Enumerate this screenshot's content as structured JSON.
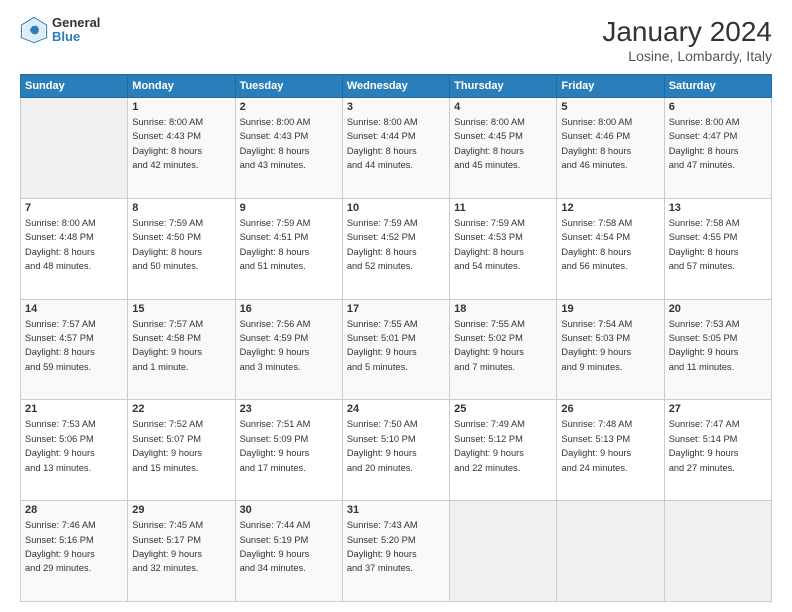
{
  "header": {
    "logo_line1": "General",
    "logo_line2": "Blue",
    "title": "January 2024",
    "subtitle": "Losine, Lombardy, Italy"
  },
  "days_of_week": [
    "Sunday",
    "Monday",
    "Tuesday",
    "Wednesday",
    "Thursday",
    "Friday",
    "Saturday"
  ],
  "weeks": [
    [
      {
        "day": "",
        "info": ""
      },
      {
        "day": "1",
        "info": "Sunrise: 8:00 AM\nSunset: 4:43 PM\nDaylight: 8 hours\nand 42 minutes."
      },
      {
        "day": "2",
        "info": "Sunrise: 8:00 AM\nSunset: 4:43 PM\nDaylight: 8 hours\nand 43 minutes."
      },
      {
        "day": "3",
        "info": "Sunrise: 8:00 AM\nSunset: 4:44 PM\nDaylight: 8 hours\nand 44 minutes."
      },
      {
        "day": "4",
        "info": "Sunrise: 8:00 AM\nSunset: 4:45 PM\nDaylight: 8 hours\nand 45 minutes."
      },
      {
        "day": "5",
        "info": "Sunrise: 8:00 AM\nSunset: 4:46 PM\nDaylight: 8 hours\nand 46 minutes."
      },
      {
        "day": "6",
        "info": "Sunrise: 8:00 AM\nSunset: 4:47 PM\nDaylight: 8 hours\nand 47 minutes."
      }
    ],
    [
      {
        "day": "7",
        "info": "Sunrise: 8:00 AM\nSunset: 4:48 PM\nDaylight: 8 hours\nand 48 minutes."
      },
      {
        "day": "8",
        "info": "Sunrise: 7:59 AM\nSunset: 4:50 PM\nDaylight: 8 hours\nand 50 minutes."
      },
      {
        "day": "9",
        "info": "Sunrise: 7:59 AM\nSunset: 4:51 PM\nDaylight: 8 hours\nand 51 minutes."
      },
      {
        "day": "10",
        "info": "Sunrise: 7:59 AM\nSunset: 4:52 PM\nDaylight: 8 hours\nand 52 minutes."
      },
      {
        "day": "11",
        "info": "Sunrise: 7:59 AM\nSunset: 4:53 PM\nDaylight: 8 hours\nand 54 minutes."
      },
      {
        "day": "12",
        "info": "Sunrise: 7:58 AM\nSunset: 4:54 PM\nDaylight: 8 hours\nand 56 minutes."
      },
      {
        "day": "13",
        "info": "Sunrise: 7:58 AM\nSunset: 4:55 PM\nDaylight: 8 hours\nand 57 minutes."
      }
    ],
    [
      {
        "day": "14",
        "info": "Sunrise: 7:57 AM\nSunset: 4:57 PM\nDaylight: 8 hours\nand 59 minutes."
      },
      {
        "day": "15",
        "info": "Sunrise: 7:57 AM\nSunset: 4:58 PM\nDaylight: 9 hours\nand 1 minute."
      },
      {
        "day": "16",
        "info": "Sunrise: 7:56 AM\nSunset: 4:59 PM\nDaylight: 9 hours\nand 3 minutes."
      },
      {
        "day": "17",
        "info": "Sunrise: 7:55 AM\nSunset: 5:01 PM\nDaylight: 9 hours\nand 5 minutes."
      },
      {
        "day": "18",
        "info": "Sunrise: 7:55 AM\nSunset: 5:02 PM\nDaylight: 9 hours\nand 7 minutes."
      },
      {
        "day": "19",
        "info": "Sunrise: 7:54 AM\nSunset: 5:03 PM\nDaylight: 9 hours\nand 9 minutes."
      },
      {
        "day": "20",
        "info": "Sunrise: 7:53 AM\nSunset: 5:05 PM\nDaylight: 9 hours\nand 11 minutes."
      }
    ],
    [
      {
        "day": "21",
        "info": "Sunrise: 7:53 AM\nSunset: 5:06 PM\nDaylight: 9 hours\nand 13 minutes."
      },
      {
        "day": "22",
        "info": "Sunrise: 7:52 AM\nSunset: 5:07 PM\nDaylight: 9 hours\nand 15 minutes."
      },
      {
        "day": "23",
        "info": "Sunrise: 7:51 AM\nSunset: 5:09 PM\nDaylight: 9 hours\nand 17 minutes."
      },
      {
        "day": "24",
        "info": "Sunrise: 7:50 AM\nSunset: 5:10 PM\nDaylight: 9 hours\nand 20 minutes."
      },
      {
        "day": "25",
        "info": "Sunrise: 7:49 AM\nSunset: 5:12 PM\nDaylight: 9 hours\nand 22 minutes."
      },
      {
        "day": "26",
        "info": "Sunrise: 7:48 AM\nSunset: 5:13 PM\nDaylight: 9 hours\nand 24 minutes."
      },
      {
        "day": "27",
        "info": "Sunrise: 7:47 AM\nSunset: 5:14 PM\nDaylight: 9 hours\nand 27 minutes."
      }
    ],
    [
      {
        "day": "28",
        "info": "Sunrise: 7:46 AM\nSunset: 5:16 PM\nDaylight: 9 hours\nand 29 minutes."
      },
      {
        "day": "29",
        "info": "Sunrise: 7:45 AM\nSunset: 5:17 PM\nDaylight: 9 hours\nand 32 minutes."
      },
      {
        "day": "30",
        "info": "Sunrise: 7:44 AM\nSunset: 5:19 PM\nDaylight: 9 hours\nand 34 minutes."
      },
      {
        "day": "31",
        "info": "Sunrise: 7:43 AM\nSunset: 5:20 PM\nDaylight: 9 hours\nand 37 minutes."
      },
      {
        "day": "",
        "info": ""
      },
      {
        "day": "",
        "info": ""
      },
      {
        "day": "",
        "info": ""
      }
    ]
  ]
}
